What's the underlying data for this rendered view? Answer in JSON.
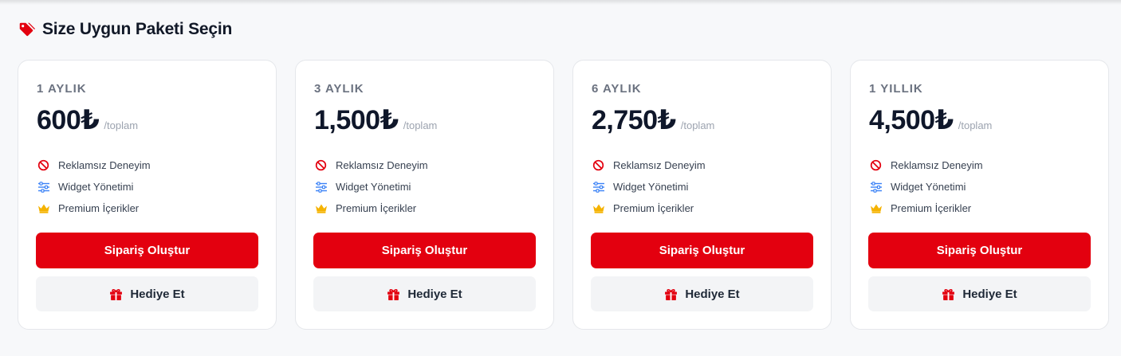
{
  "section": {
    "title": "Size Uygun Paketi Seçin",
    "icon": "tag-icon"
  },
  "colors": {
    "accent": "#e3000f",
    "gift_button_bg": "#f3f4f6",
    "crown": "#f5b301",
    "sliders": "#3b82f6"
  },
  "plans": [
    {
      "name": "1 AYLIK",
      "price": "600₺",
      "price_suffix": "/toplam",
      "features": [
        {
          "icon": "ban-icon",
          "label": "Reklamsız Deneyim"
        },
        {
          "icon": "sliders-icon",
          "label": "Widget Yönetimi"
        },
        {
          "icon": "crown-icon",
          "label": "Premium İçerikler"
        }
      ],
      "order_label": "Sipariş Oluştur",
      "gift_label": "Hediye Et"
    },
    {
      "name": "3 AYLIK",
      "price": "1,500₺",
      "price_suffix": "/toplam",
      "features": [
        {
          "icon": "ban-icon",
          "label": "Reklamsız Deneyim"
        },
        {
          "icon": "sliders-icon",
          "label": "Widget Yönetimi"
        },
        {
          "icon": "crown-icon",
          "label": "Premium İçerikler"
        }
      ],
      "order_label": "Sipariş Oluştur",
      "gift_label": "Hediye Et"
    },
    {
      "name": "6 AYLIK",
      "price": "2,750₺",
      "price_suffix": "/toplam",
      "features": [
        {
          "icon": "ban-icon",
          "label": "Reklamsız Deneyim"
        },
        {
          "icon": "sliders-icon",
          "label": "Widget Yönetimi"
        },
        {
          "icon": "crown-icon",
          "label": "Premium İçerikler"
        }
      ],
      "order_label": "Sipariş Oluştur",
      "gift_label": "Hediye Et"
    },
    {
      "name": "1 YILLIK",
      "price": "4,500₺",
      "price_suffix": "/toplam",
      "features": [
        {
          "icon": "ban-icon",
          "label": "Reklamsız Deneyim"
        },
        {
          "icon": "sliders-icon",
          "label": "Widget Yönetimi"
        },
        {
          "icon": "crown-icon",
          "label": "Premium İçerikler"
        }
      ],
      "order_label": "Sipariş Oluştur",
      "gift_label": "Hediye Et"
    }
  ]
}
